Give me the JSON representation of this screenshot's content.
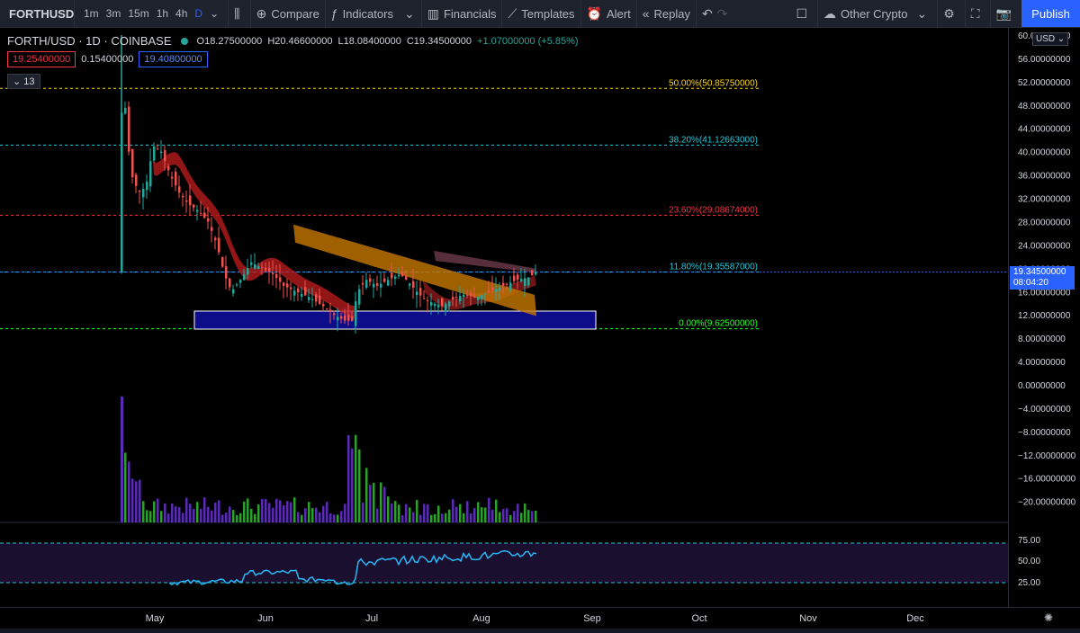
{
  "toolbar": {
    "symbol": "FORTHUSD",
    "timeframes": [
      "1m",
      "3m",
      "15m",
      "1h",
      "4h",
      "D"
    ],
    "active_timeframe": "D",
    "compare": "Compare",
    "indicators": "Indicators",
    "financials": "Financials",
    "templates": "Templates",
    "alert": "Alert",
    "replay": "Replay",
    "other_crypto": "Other Crypto",
    "publish": "Publish"
  },
  "legend": {
    "title": "FORTH/USD · 1D · COINBASE",
    "open": "O18.27500000",
    "high": "H20.46600000",
    "low": "L18.08400000",
    "close": "C19.34500000",
    "change": "+1.07000000 (+5.85%)",
    "bid": "19.25400000",
    "spread": "0.15400000",
    "ask": "19.40800000",
    "indicator_count": "13"
  },
  "price_axis": {
    "currency": "USD",
    "labels": [
      "60.00000000",
      "56.00000000",
      "52.00000000",
      "48.00000000",
      "44.00000000",
      "40.00000000",
      "36.00000000",
      "32.00000000",
      "28.00000000",
      "24.00000000",
      "20.00000000",
      "16.00000000",
      "12.00000000",
      "8.00000000",
      "4.00000000",
      "0.00000000",
      "−4.00000000",
      "−8.00000000",
      "−12.00000000",
      "−16.00000000",
      "−20.00000000"
    ],
    "current_price": "19.34500000",
    "countdown": "08:04:20",
    "rsi_labels": [
      "75.00",
      "50.00",
      "25.00"
    ]
  },
  "fib_levels": [
    {
      "label": "50.00%(50.85750000)",
      "price": 50.8575,
      "color": "#f9d423"
    },
    {
      "label": "38.20%(41.12663000)",
      "price": 41.12663,
      "color": "#26c6da"
    },
    {
      "label": "23.60%(29.08674000)",
      "price": 29.08674,
      "color": "#f23645"
    },
    {
      "label": "11.80%(19.35587000)",
      "price": 19.35587,
      "color": "#26c6da"
    },
    {
      "label": "0.00%(9.62500000)",
      "price": 9.625,
      "color": "#26ff26"
    }
  ],
  "time_axis": [
    "May",
    "Jun",
    "Jul",
    "Aug",
    "Sep",
    "Oct",
    "Nov",
    "Dec"
  ],
  "colors": {
    "up": "#26a69a",
    "down": "#ef5350",
    "accent": "#2962ff",
    "rsi": "#29b6f6",
    "volume_up": "#2ca02c",
    "volume_down": "#5b2bb5"
  }
}
